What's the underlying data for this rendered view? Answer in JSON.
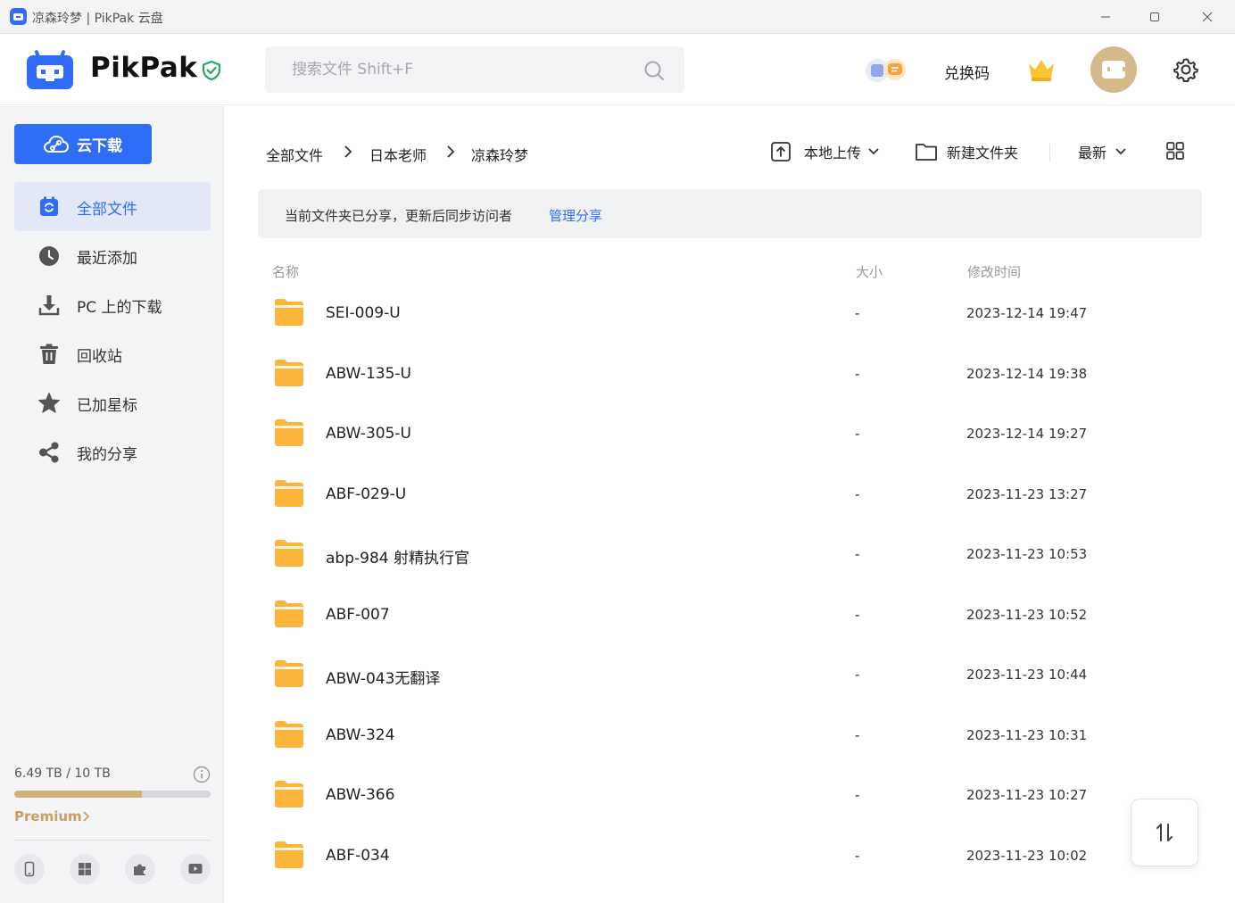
{
  "window": {
    "title": "凉森玲梦 | PikPak 云盘"
  },
  "header": {
    "brand": "PikPak",
    "search_placeholder": "搜索文件 Shift+F",
    "redeem_label": "兑换码"
  },
  "sidebar": {
    "cloud_download_label": "云下载",
    "items": [
      {
        "label": "全部文件",
        "icon": "all-files-icon",
        "active": true
      },
      {
        "label": "最近添加",
        "icon": "clock-icon",
        "active": false
      },
      {
        "label": "PC 上的下载",
        "icon": "download-icon",
        "active": false
      },
      {
        "label": "回收站",
        "icon": "trash-icon",
        "active": false
      },
      {
        "label": "已加星标",
        "icon": "star-icon",
        "active": false
      },
      {
        "label": "我的分享",
        "icon": "share-icon",
        "active": false
      }
    ],
    "storage": {
      "text": "6.49 TB / 10 TB",
      "used_fraction": 0.649
    },
    "premium_label": "Premium",
    "platforms": [
      "mobile-icon",
      "windows-icon",
      "extension-icon",
      "tv-icon"
    ]
  },
  "main": {
    "breadcrumb": [
      "全部文件",
      "日本老师",
      "凉森玲梦"
    ],
    "toolbar": {
      "upload_label": "本地上传",
      "new_folder_label": "新建文件夹",
      "sort_label": "最新"
    },
    "notice": {
      "message": "当前文件夹已分享，更新后同步访问者",
      "link": "管理分享"
    },
    "columns": {
      "name": "名称",
      "size": "大小",
      "modified": "修改时间"
    },
    "files": [
      {
        "name": "SEI-009-U",
        "size": "-",
        "modified": "2023-12-14 19:47"
      },
      {
        "name": "ABW-135-U",
        "size": "-",
        "modified": "2023-12-14 19:38"
      },
      {
        "name": "ABW-305-U",
        "size": "-",
        "modified": "2023-12-14 19:27"
      },
      {
        "name": "ABF-029-U",
        "size": "-",
        "modified": "2023-11-23 13:27"
      },
      {
        "name": "abp-984 射精执行官",
        "size": "-",
        "modified": "2023-11-23 10:53"
      },
      {
        "name": "ABF-007",
        "size": "-",
        "modified": "2023-11-23 10:52"
      },
      {
        "name": "ABW-043无翻译",
        "size": "-",
        "modified": "2023-11-23 10:44"
      },
      {
        "name": "ABW-324",
        "size": "-",
        "modified": "2023-11-23 10:31"
      },
      {
        "name": "ABW-366",
        "size": "-",
        "modified": "2023-11-23 10:27"
      },
      {
        "name": "ABF-034",
        "size": "-",
        "modified": "2023-11-23 10:02"
      }
    ]
  },
  "colors": {
    "accent": "#2f6df6",
    "folder": "#fbb53c",
    "premium": "#c9a063",
    "sidebar_bg": "#f3f4f6"
  }
}
